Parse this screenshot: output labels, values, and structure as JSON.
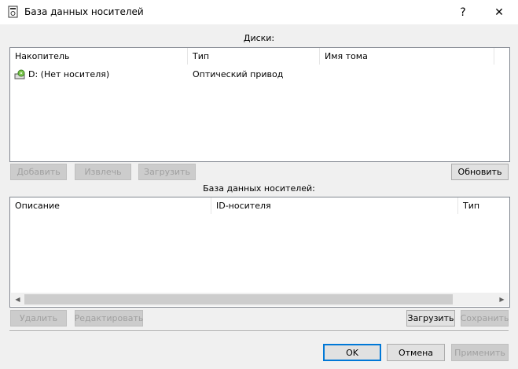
{
  "window": {
    "title": "База данных носителей",
    "help_label": "?",
    "close_label": "✕"
  },
  "disks": {
    "section_label": "Диски:",
    "columns": [
      "Накопитель",
      "Тип",
      "Имя тома"
    ],
    "rows": [
      {
        "drive": "D: (Нет носителя)",
        "type": "Оптический привод",
        "volume": ""
      }
    ],
    "buttons": {
      "add": "Добавить",
      "eject": "Извлечь",
      "load": "Загрузить",
      "refresh": "Обновить"
    }
  },
  "media_db": {
    "section_label": "База данных носителей:",
    "columns": [
      "Описание",
      "ID-носителя",
      "Тип"
    ],
    "rows": [],
    "buttons": {
      "delete": "Удалить",
      "edit": "Редактировать",
      "load": "Загрузить",
      "save": "Сохранить"
    }
  },
  "footer": {
    "ok": "OK",
    "cancel": "Отмена",
    "apply": "Применить"
  },
  "colors": {
    "accent": "#0078d7",
    "disabled_text": "#a0a0a0"
  }
}
